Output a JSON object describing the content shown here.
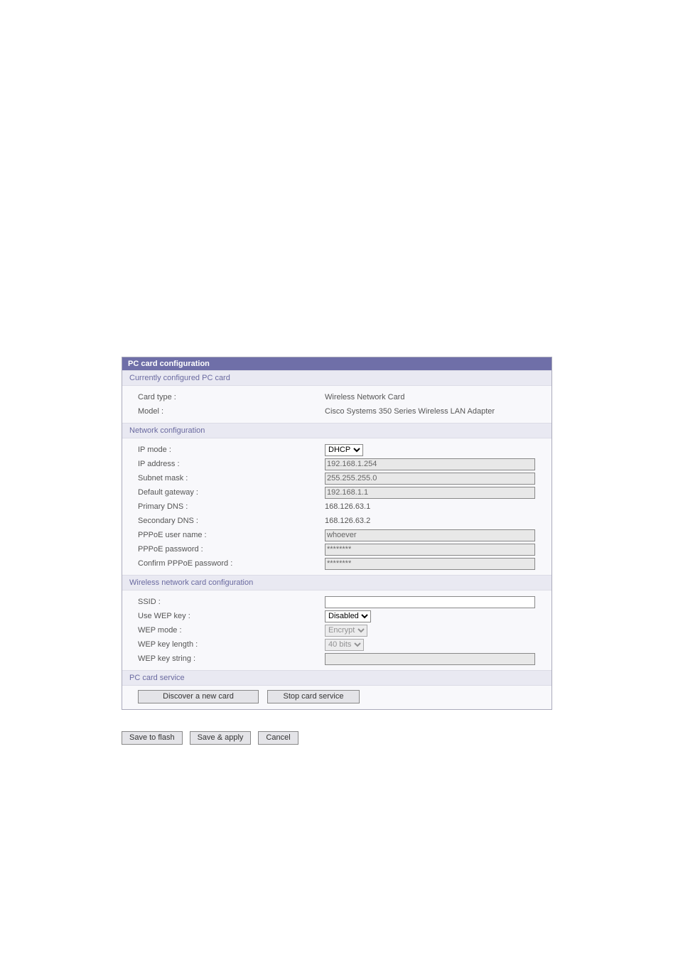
{
  "panel": {
    "title": "PC card configuration"
  },
  "sections": {
    "current": {
      "header": "Currently configured PC card",
      "card_type_label": "Card type :",
      "model_label": "Model :",
      "card_type_value": "Wireless Network Card",
      "model_value": "Cisco Systems 350 Series Wireless LAN Adapter"
    },
    "network": {
      "header": "Network configuration",
      "ip_mode_label": "IP mode :",
      "ip_mode_value": "DHCP",
      "ip_address_label": "IP address :",
      "ip_address_value": "192.168.1.254",
      "subnet_label": "Subnet mask :",
      "subnet_value": "255.255.255.0",
      "gateway_label": "Default gateway :",
      "gateway_value": "192.168.1.1",
      "primary_dns_label": "Primary DNS :",
      "primary_dns_value": "168.126.63.1",
      "secondary_dns_label": "Secondary DNS :",
      "secondary_dns_value": "168.126.63.2",
      "pppoe_user_label": "PPPoE user name :",
      "pppoe_user_value": "whoever",
      "pppoe_pass_label": "PPPoE password :",
      "pppoe_pass_value": "********",
      "pppoe_conf_label": "Confirm PPPoE password :",
      "pppoe_conf_value": "********"
    },
    "wireless": {
      "header": "Wireless network card configuration",
      "ssid_label": "SSID :",
      "ssid_value": "",
      "use_wep_label": "Use WEP key :",
      "use_wep_value": "Disabled",
      "wep_mode_label": "WEP mode :",
      "wep_mode_value": "Encrypt",
      "wep_len_label": "WEP key length :",
      "wep_len_value": "40 bits",
      "wep_str_label": "WEP key string :",
      "wep_str_value": ""
    },
    "service": {
      "header": "PC card service",
      "discover_button": "Discover a new card",
      "stop_button": "Stop card service"
    }
  },
  "bottom": {
    "save_flash": "Save to flash",
    "save_apply": "Save & apply",
    "cancel": "Cancel"
  }
}
